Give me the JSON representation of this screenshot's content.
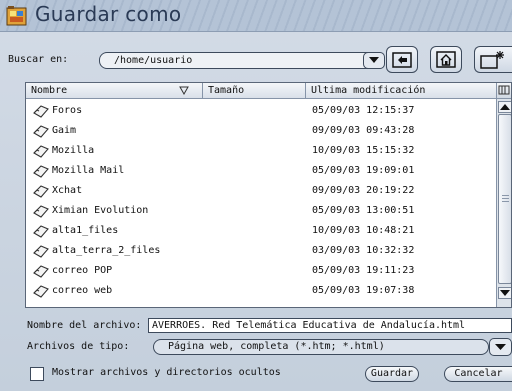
{
  "window": {
    "title": "Guardar como"
  },
  "toolbar": {
    "look_in_label": "Buscar en:",
    "path": "/home/usuario"
  },
  "columns": {
    "name": "Nombre",
    "size": "Tamaño",
    "modified": "Ultima modificación"
  },
  "files": [
    {
      "name": "Foros",
      "size": "",
      "modified": "05/09/03 12:15:37"
    },
    {
      "name": "Gaim",
      "size": "",
      "modified": "09/09/03 09:43:28"
    },
    {
      "name": "Mozilla",
      "size": "",
      "modified": "10/09/03 15:15:32"
    },
    {
      "name": "Mozilla Mail",
      "size": "",
      "modified": "05/09/03 19:09:01"
    },
    {
      "name": "Xchat",
      "size": "",
      "modified": "09/09/03 20:19:22"
    },
    {
      "name": "Ximian Evolution",
      "size": "",
      "modified": "05/09/03 13:00:51"
    },
    {
      "name": "alta1_files",
      "size": "",
      "modified": "10/09/03 10:48:21"
    },
    {
      "name": "alta_terra_2_files",
      "size": "",
      "modified": "03/09/03 10:32:32"
    },
    {
      "name": "correo POP",
      "size": "",
      "modified": "05/09/03 19:11:23"
    },
    {
      "name": "correo web",
      "size": "",
      "modified": "05/09/03 19:07:38"
    }
  ],
  "form": {
    "filename_label": "Nombre del archivo:",
    "filename_value": "AVERROES. Red Telemática Educativa de Andalucía.html",
    "filetype_label": "Archivos de tipo:",
    "filetype_value": "Página web, completa (*.htm; *.html)",
    "show_hidden_label": "Mostrar archivos y directorios ocultos"
  },
  "buttons": {
    "save": "Guardar",
    "cancel": "Cancelar"
  }
}
